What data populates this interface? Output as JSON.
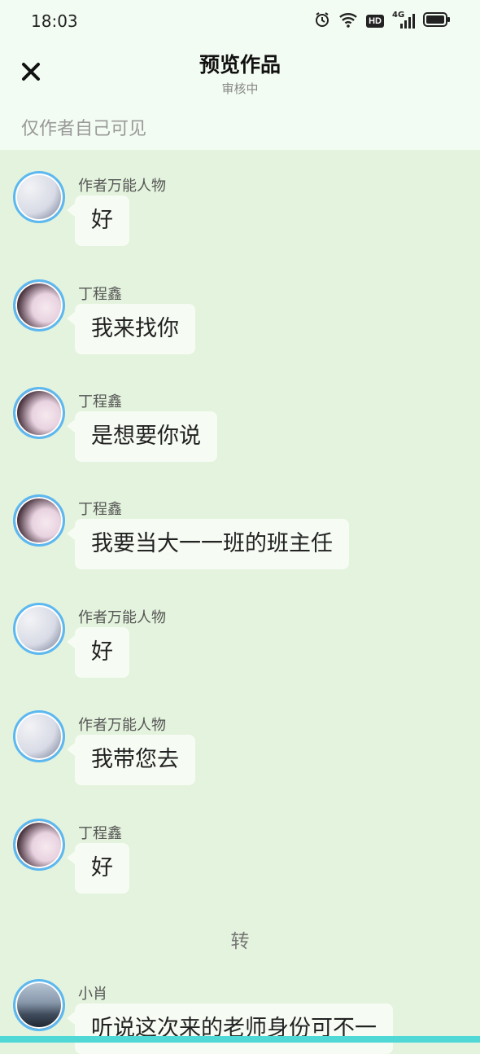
{
  "status_bar": {
    "time": "18:03",
    "network": "4G",
    "hd": "HD"
  },
  "header": {
    "title": "预览作品",
    "subtitle": "审核中",
    "visibility": "仅作者自己可见"
  },
  "messages": [
    {
      "name": "作者万能人物",
      "text": "好"
    },
    {
      "name": "丁程鑫",
      "text": "我来找你"
    },
    {
      "name": "丁程鑫",
      "text": "是想要你说"
    },
    {
      "name": "丁程鑫",
      "text": "我要当大一一班的班主任"
    },
    {
      "name": "作者万能人物",
      "text": "好"
    },
    {
      "name": "作者万能人物",
      "text": "我带您去"
    },
    {
      "name": "丁程鑫",
      "text": "好"
    },
    {
      "name": "小肖",
      "text": "听说这次来的老师身份可不一"
    }
  ],
  "divider": "转",
  "colors": {
    "background": "#e4f3dd",
    "header": "#f3fcf2",
    "bubble": "#f6fcf4",
    "avatar_ring": "#5cb8f0",
    "accent_strip": "#4fd8d6"
  }
}
